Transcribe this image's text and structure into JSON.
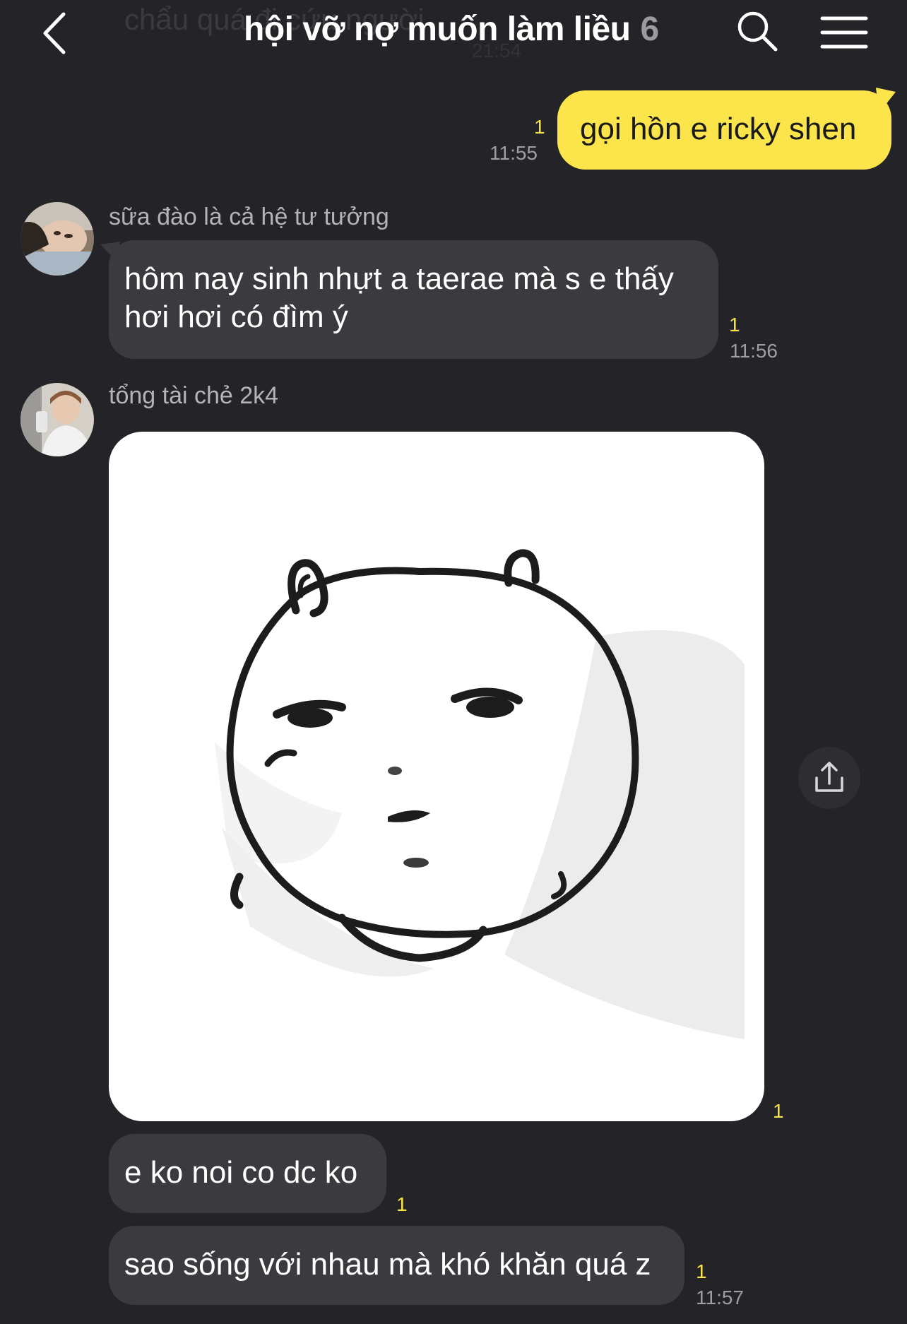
{
  "header": {
    "title": "hội vỡ nợ muốn làm liều",
    "member_count": "6",
    "ghost_text": "chẩu quá đi cứu người",
    "ghost_time": "21:54",
    "icons": {
      "back": "chevron-left-icon",
      "search": "search-icon",
      "menu": "hamburger-menu-icon"
    }
  },
  "colors": {
    "background": "#242428",
    "outgoing_bubble": "#fbe54b",
    "incoming_bubble": "#3b3b3f",
    "unread_count": "#f7e34a"
  },
  "messages": [
    {
      "direction": "outgoing",
      "text": "gọi hồn e ricky shen",
      "unread": "1",
      "time": "11:55"
    },
    {
      "direction": "incoming",
      "sender": "sữa đào là cả hệ tư tưởng",
      "text_line1": "hôm nay sinh nhựt a taerae mà s e thấy",
      "text_line2": "hơi hơi có đìm ý",
      "unread": "1",
      "time": "11:56"
    },
    {
      "direction": "incoming",
      "sender": "tổng tài chẻ 2k4",
      "type": "sticker",
      "sticker_icon": "doodle-bear-face-sticker",
      "unread": "1",
      "share_icon": "share-upload-icon"
    },
    {
      "direction": "incoming",
      "text": "e ko noi co dc ko",
      "unread": "1"
    },
    {
      "direction": "incoming",
      "text": "sao sống với nhau mà khó khăn quá z",
      "unread": "1",
      "time": "11:57"
    }
  ]
}
